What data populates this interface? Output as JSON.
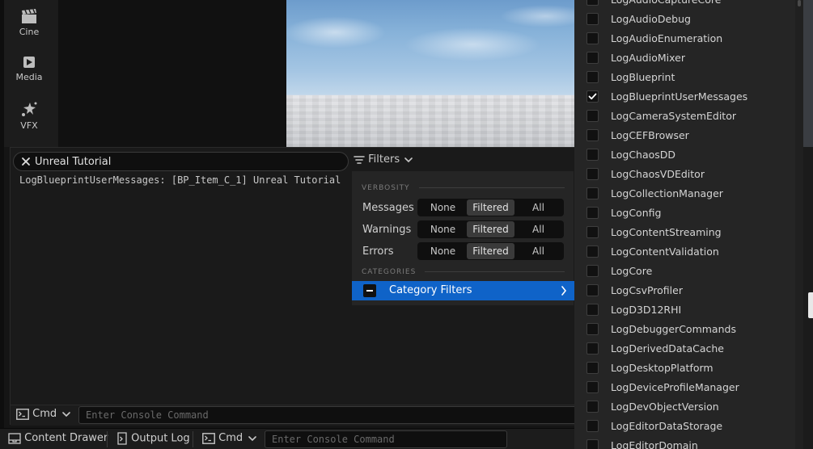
{
  "toolbar": {
    "items": [
      {
        "label": "Cine",
        "icon": "clapperboard-icon"
      },
      {
        "label": "Media",
        "icon": "media-icon"
      },
      {
        "label": "VFX",
        "icon": "vfx-icon"
      }
    ]
  },
  "output_log": {
    "search_value": "Unreal Tutorial",
    "filters_label": "Filters",
    "log_lines": [
      "LogBlueprintUserMessages: [BP_Item_C_1] Unreal Tutorial"
    ],
    "cmd_label": "Cmd",
    "console_placeholder": "Enter Console Command"
  },
  "filters_menu": {
    "verbosity_header": "VERBOSITY",
    "categories_header": "CATEGORIES",
    "rows": [
      {
        "label": "Messages",
        "selected": "Filtered"
      },
      {
        "label": "Warnings",
        "selected": "Filtered"
      },
      {
        "label": "Errors",
        "selected": "Filtered"
      }
    ],
    "options": [
      "None",
      "Filtered",
      "All"
    ],
    "category_filters_label": "Category Filters"
  },
  "category_list": [
    {
      "name": "LogAudioCaptureCore",
      "checked": false
    },
    {
      "name": "LogAudioDebug",
      "checked": false
    },
    {
      "name": "LogAudioEnumeration",
      "checked": false
    },
    {
      "name": "LogAudioMixer",
      "checked": false
    },
    {
      "name": "LogBlueprint",
      "checked": false
    },
    {
      "name": "LogBlueprintUserMessages",
      "checked": true
    },
    {
      "name": "LogCameraSystemEditor",
      "checked": false
    },
    {
      "name": "LogCEFBrowser",
      "checked": false
    },
    {
      "name": "LogChaosDD",
      "checked": false
    },
    {
      "name": "LogChaosVDEditor",
      "checked": false
    },
    {
      "name": "LogCollectionManager",
      "checked": false
    },
    {
      "name": "LogConfig",
      "checked": false
    },
    {
      "name": "LogContentStreaming",
      "checked": false
    },
    {
      "name": "LogContentValidation",
      "checked": false
    },
    {
      "name": "LogCore",
      "checked": false
    },
    {
      "name": "LogCsvProfiler",
      "checked": false
    },
    {
      "name": "LogD3D12RHI",
      "checked": false
    },
    {
      "name": "LogDebuggerCommands",
      "checked": false
    },
    {
      "name": "LogDerivedDataCache",
      "checked": false
    },
    {
      "name": "LogDesktopPlatform",
      "checked": false
    },
    {
      "name": "LogDeviceProfileManager",
      "checked": false
    },
    {
      "name": "LogDevObjectVersion",
      "checked": false
    },
    {
      "name": "LogEditorDataStorage",
      "checked": false
    },
    {
      "name": "LogEditorDomain",
      "checked": false
    }
  ],
  "status_bar": {
    "content_drawer": "Content Drawer",
    "output_log": "Output Log",
    "cmd_label": "Cmd",
    "console_placeholder": "Enter Console Command"
  },
  "colors": {
    "accent": "#0f63c8",
    "panel_bg": "#1a1a1a",
    "menu_bg": "#252525"
  }
}
